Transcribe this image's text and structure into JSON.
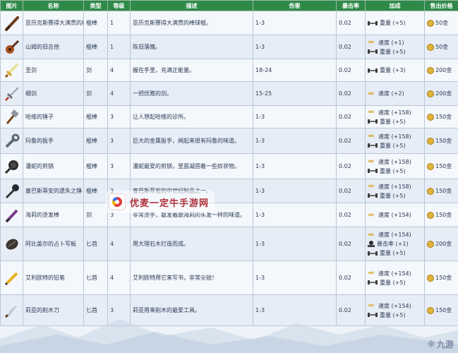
{
  "headers": {
    "image": "图片",
    "name": "名称",
    "type": "类型",
    "level": "等级",
    "desc": "描述",
    "damage": "伤害",
    "crit": "暴击率",
    "bonus": "加成",
    "sell": "售出价格"
  },
  "rows": [
    {
      "icon": "bat-icon",
      "name": "亚历克斯赛得大满贯的棒球棍",
      "type": "棍棒",
      "level": "1",
      "desc": "亚历克斯赛得大满贯的棒球棍。",
      "damage": "1-3",
      "crit": "0.02",
      "bonus": [
        {
          "icon": "weight-icon",
          "text": "重量 (+5)"
        }
      ],
      "sell": "50金"
    },
    {
      "icon": "guitar-icon",
      "name": "山姆的旧吉他",
      "type": "棍棒",
      "level": "1",
      "desc": "陈旧落魄。",
      "damage": "1-3",
      "crit": "0.02",
      "bonus": [
        {
          "icon": "speed-icon",
          "text": "速度 (+1)"
        },
        {
          "icon": "weight-icon",
          "text": "重量 (+5)"
        }
      ],
      "sell": "50金"
    },
    {
      "icon": "holy-sword-icon",
      "name": "圣剑",
      "type": "剑",
      "level": "4",
      "desc": "握在手里，充满正能量。",
      "damage": "18-24",
      "crit": "0.02",
      "bonus": [
        {
          "icon": "weight-icon",
          "text": "重量 (+3)"
        }
      ],
      "sell": "200金"
    },
    {
      "icon": "rapier-icon",
      "name": "细剑",
      "type": "剑",
      "level": "4",
      "desc": "一把优雅的剑。",
      "damage": "15-25",
      "crit": "0.02",
      "bonus": [
        {
          "icon": "speed-icon",
          "text": "速度 (+2)"
        }
      ],
      "sell": "200金"
    },
    {
      "icon": "hammer-icon",
      "name": "哈维的锤子",
      "type": "棍棒",
      "level": "3",
      "desc": "让人想起哈维的诊所。",
      "damage": "1-3",
      "crit": "0.02",
      "bonus": [
        {
          "icon": "speed-icon",
          "text": "速度 (+158)"
        },
        {
          "icon": "weight-icon",
          "text": "重量 (+5)"
        }
      ],
      "sell": "150金"
    },
    {
      "icon": "wrench-icon",
      "name": "玛鲁的扳手",
      "type": "棍棒",
      "level": "3",
      "desc": "巨大的金属扳手，闻起来很有玛鲁的味道。",
      "damage": "1-3",
      "crit": "0.02",
      "bonus": [
        {
          "icon": "speed-icon",
          "text": "速度 (+158)"
        },
        {
          "icon": "weight-icon",
          "text": "重量 (+5)"
        }
      ],
      "sell": "150金"
    },
    {
      "icon": "pan-icon",
      "name": "潘妮的煎锅",
      "type": "棍棒",
      "level": "3",
      "desc": "潘妮最爱的煎锅，里面凝固着一些奴状物。",
      "damage": "1-3",
      "crit": "0.02",
      "bonus": [
        {
          "icon": "speed-icon",
          "text": "速度 (+158)"
        },
        {
          "icon": "weight-icon",
          "text": "重量 (+5)"
        }
      ],
      "sell": "150金"
    },
    {
      "icon": "scepter-icon",
      "name": "塞巴斯蒂安的遗失之锤",
      "type": "棍棒",
      "level": "3",
      "desc": "塞巴斯蒂安的中世纪制品之一。",
      "damage": "1-3",
      "crit": "0.02",
      "bonus": [
        {
          "icon": "speed-icon",
          "text": "速度 (+158)"
        },
        {
          "icon": "weight-icon",
          "text": "重量 (+5)"
        }
      ],
      "sell": "150金"
    },
    {
      "icon": "curling-iron-icon",
      "name": "海莉的烫发棒",
      "type": "剑",
      "level": "3",
      "desc": "非常烫手，散发着跟海莉的头发一样的味道。",
      "damage": "1-3",
      "crit": "0.02",
      "bonus": [
        {
          "icon": "speed-icon",
          "text": "速度 (+154)"
        }
      ],
      "sell": "150金"
    },
    {
      "icon": "stone-dagger-icon",
      "name": "阿比盖尔的占卜写板",
      "type": "匕首",
      "level": "4",
      "desc": "用大理石木打造而成。",
      "damage": "1-3",
      "crit": "0.02",
      "bonus": [
        {
          "icon": "speed-icon",
          "text": "速度 (+154)"
        },
        {
          "icon": "crit-icon",
          "text": "暴击率 (+1)"
        },
        {
          "icon": "weight-icon",
          "text": "重量 (+5)"
        }
      ],
      "sell": "200金"
    },
    {
      "icon": "pencil-icon",
      "name": "艾利欧特的铅笔",
      "type": "匕首",
      "level": "4",
      "desc": "艾利欧特用它来写书，非常尖锐！",
      "damage": "1-3",
      "crit": "0.02",
      "bonus": [
        {
          "icon": "speed-icon",
          "text": "速度 (+154)"
        },
        {
          "icon": "weight-icon",
          "text": "重量 (+5)"
        }
      ],
      "sell": "150金"
    },
    {
      "icon": "carving-knife-icon",
      "name": "莉亚的削木刀",
      "type": "匕首",
      "level": "3",
      "desc": "莉亚用来削木的最爱工具。",
      "damage": "1-3",
      "crit": "0.02",
      "bonus": [
        {
          "icon": "speed-icon",
          "text": "速度 (+154)"
        },
        {
          "icon": "weight-icon",
          "text": "重量 (+5)"
        }
      ],
      "sell": "150金"
    }
  ],
  "watermark": {
    "text": "优麦一定牛手游网"
  },
  "corner_brand": {
    "text": "九游"
  }
}
